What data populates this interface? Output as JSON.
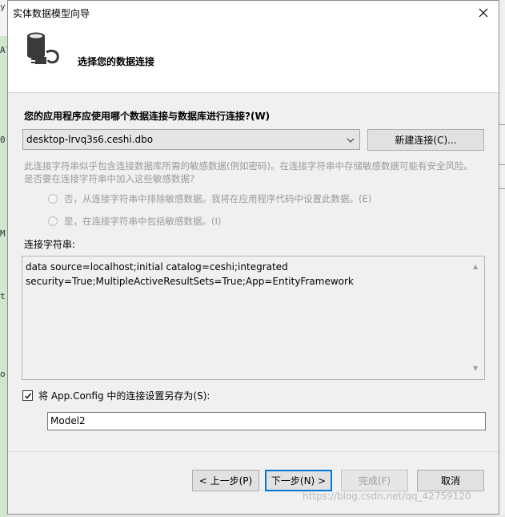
{
  "dialog": {
    "title": "实体数据模型向导",
    "header": "选择您的数据连接"
  },
  "question": "您的应用程序应使用哪个数据连接与数据库进行连接?(W)",
  "connection": {
    "selected": "desktop-lrvq3s6.ceshi.dbo",
    "new_button": "新建连接(C)..."
  },
  "warning": "此连接字符串似乎包含连接数据库所需的敏感数据(例如密码)。在连接字符串中存储敏感数据可能有安全风险。是否要在连接字符串中加入这些敏感数据?",
  "options": {
    "no": "否，从连接字符串中排除敏感数据。我将在应用程序代码中设置此数据。(E)",
    "yes": "是，在连接字符串中包括敏感数据。(I)"
  },
  "connstring": {
    "label": "连接字符串:",
    "value": "data source=localhost;initial catalog=ceshi;integrated security=True;MultipleActiveResultSets=True;App=EntityFramework"
  },
  "save": {
    "label": "将 App.Config 中的连接设置另存为(S):",
    "checked": true,
    "name": "Model2"
  },
  "buttons": {
    "back": "< 上一步(P)",
    "next": "下一步(N) >",
    "finish": "完成(F)",
    "cancel": "取消"
  },
  "watermark": "https://blog.csdn.net/qq_42759120",
  "background": {
    "left_glyphs": [
      "y",
      "Al",
      "0",
      "M",
      "t",
      "o"
    ]
  }
}
